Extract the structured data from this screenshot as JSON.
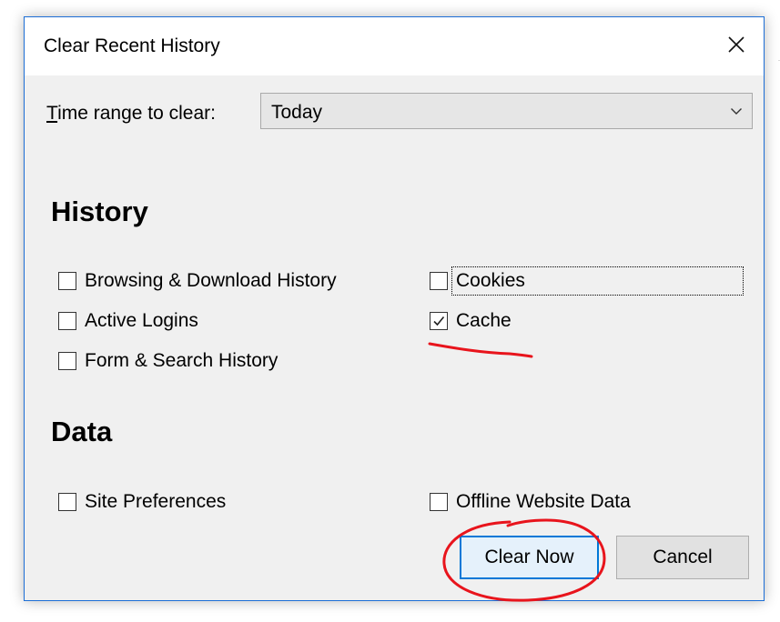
{
  "dialog": {
    "title": "Clear Recent History",
    "close_icon": "close-icon"
  },
  "time_range": {
    "label_accesskey": "T",
    "label_rest": "ime range to clear:",
    "value": "Today",
    "dropdown_icon": "chevron-down-icon"
  },
  "history": {
    "heading": "History",
    "items": [
      {
        "label": "Browsing & Download History",
        "checked": false
      },
      {
        "label": "Active Logins",
        "checked": false
      },
      {
        "label": "Form & Search History",
        "checked": false
      },
      {
        "label": "Cookies",
        "checked": false,
        "focused": true
      },
      {
        "label": "Cache",
        "checked": true
      }
    ]
  },
  "data": {
    "heading": "Data",
    "items": [
      {
        "label": "Site Preferences",
        "checked": false
      },
      {
        "label": "Offline Website Data",
        "checked": false
      }
    ]
  },
  "buttons": {
    "clear_now": "Clear Now",
    "cancel": "Cancel"
  },
  "annotation_color": "#e8141c"
}
